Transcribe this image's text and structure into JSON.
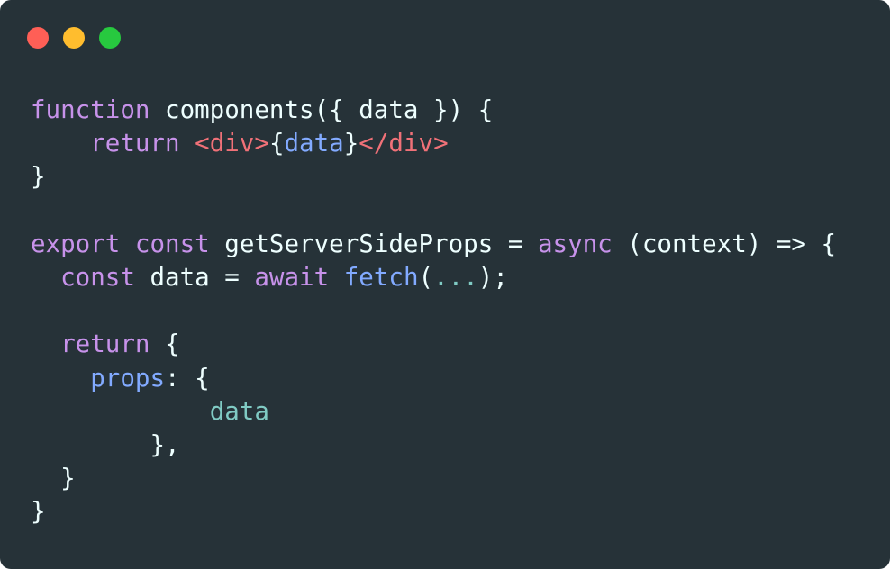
{
  "window": {
    "controls": {
      "close": {
        "icon": "close-dot-icon",
        "color": "#ff5f56"
      },
      "minimize": {
        "icon": "minimize-dot-icon",
        "color": "#ffbd2e"
      },
      "maximize": {
        "icon": "maximize-dot-icon",
        "color": "#27c93f"
      }
    },
    "background": "#263238"
  },
  "code": {
    "lines": [
      [
        {
          "t": "function",
          "c": "kw"
        },
        {
          "t": " components({ data }) {",
          "c": "plain"
        }
      ],
      [
        {
          "t": "    ",
          "c": "plain"
        },
        {
          "t": "return",
          "c": "kw"
        },
        {
          "t": " ",
          "c": "plain"
        },
        {
          "t": "<div>",
          "c": "tag"
        },
        {
          "t": "{",
          "c": "plain"
        },
        {
          "t": "data",
          "c": "fn"
        },
        {
          "t": "}",
          "c": "plain"
        },
        {
          "t": "</div>",
          "c": "tag"
        }
      ],
      [
        {
          "t": "}",
          "c": "plain"
        }
      ],
      [],
      [
        {
          "t": "export",
          "c": "kw"
        },
        {
          "t": " ",
          "c": "plain"
        },
        {
          "t": "const",
          "c": "kw"
        },
        {
          "t": " getServerSideProps = ",
          "c": "plain"
        },
        {
          "t": "async",
          "c": "kw"
        },
        {
          "t": " (context) => {",
          "c": "plain"
        }
      ],
      [
        {
          "t": "  ",
          "c": "plain"
        },
        {
          "t": "const",
          "c": "kw"
        },
        {
          "t": " data = ",
          "c": "plain"
        },
        {
          "t": "await",
          "c": "kw"
        },
        {
          "t": " ",
          "c": "plain"
        },
        {
          "t": "fetch",
          "c": "fn"
        },
        {
          "t": "(",
          "c": "plain"
        },
        {
          "t": "...",
          "c": "teal"
        },
        {
          "t": ");",
          "c": "plain"
        }
      ],
      [],
      [
        {
          "t": "  ",
          "c": "plain"
        },
        {
          "t": "return",
          "c": "kw"
        },
        {
          "t": " {",
          "c": "plain"
        }
      ],
      [
        {
          "t": "    ",
          "c": "plain"
        },
        {
          "t": "props",
          "c": "fn"
        },
        {
          "t": ": {",
          "c": "plain"
        }
      ],
      [
        {
          "t": "            ",
          "c": "plain"
        },
        {
          "t": "data",
          "c": "teal"
        }
      ],
      [
        {
          "t": "        },",
          "c": "plain"
        }
      ],
      [
        {
          "t": "  }",
          "c": "plain"
        }
      ],
      [
        {
          "t": "}",
          "c": "plain"
        }
      ]
    ]
  }
}
